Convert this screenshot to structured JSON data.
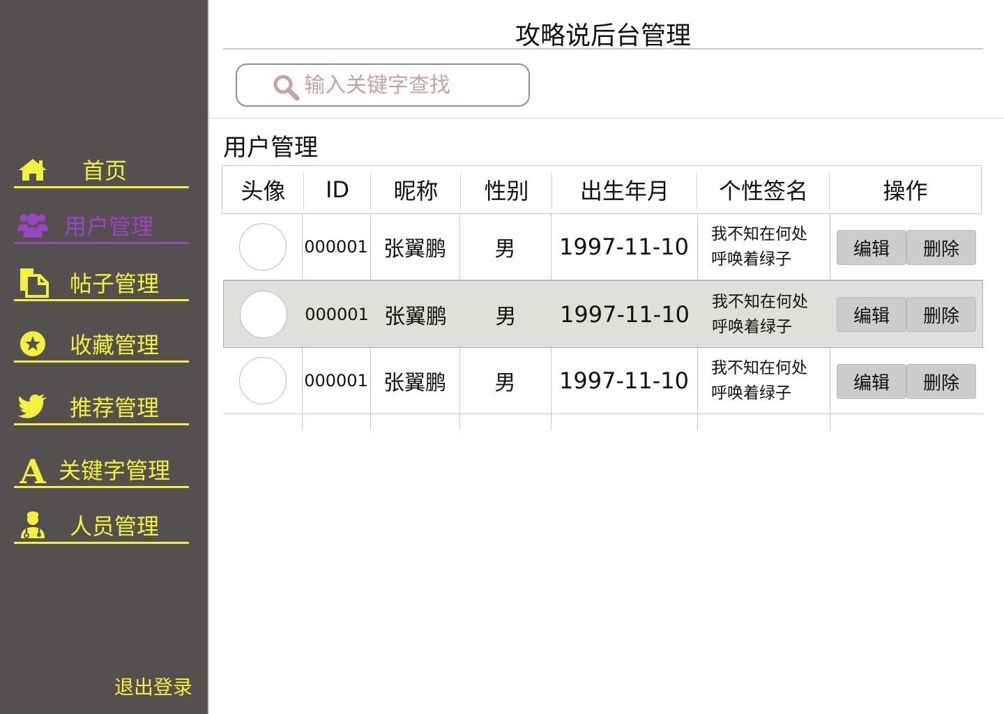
{
  "app": {
    "title": "攻略说后台管理"
  },
  "sidebar": {
    "items": [
      {
        "label": "首页",
        "icon": "home-icon"
      },
      {
        "label": "用户管理",
        "icon": "users-icon",
        "active": true
      },
      {
        "label": "帖子管理",
        "icon": "document-icon"
      },
      {
        "label": "收藏管理",
        "icon": "star-icon"
      },
      {
        "label": "推荐管理",
        "icon": "bird-icon"
      },
      {
        "label": "关键字管理",
        "icon": "letter-a-icon"
      },
      {
        "label": "人员管理",
        "icon": "doctor-icon"
      }
    ],
    "logout_label": "退出登录"
  },
  "search": {
    "placeholder": "输入关键字查找",
    "value": ""
  },
  "section": {
    "title": "用户管理"
  },
  "table": {
    "columns": [
      "头像",
      "ID",
      "昵称",
      "性别",
      "出生年月",
      "个性签名",
      "操作"
    ],
    "rows": [
      {
        "id": "000001",
        "nickname": "张翼鹏",
        "gender": "男",
        "birth": "1997-11-10",
        "signature": "我不知在何处\n呼唤着绿子",
        "edit": "编辑",
        "delete": "删除"
      },
      {
        "id": "000001",
        "nickname": "张翼鹏",
        "gender": "男",
        "birth": "1997-11-10",
        "signature": "我不知在何处\n呼唤着绿子",
        "edit": "编辑",
        "delete": "删除",
        "highlighted": true
      },
      {
        "id": "000001",
        "nickname": "张翼鹏",
        "gender": "男",
        "birth": "1997-11-10",
        "signature": "我不知在何处\n呼唤着绿子",
        "edit": "编辑",
        "delete": "删除"
      }
    ]
  },
  "colors": {
    "sidebar_bg": "#545050",
    "nav_accent": "#f2f23c",
    "active_accent": "#9a45c2",
    "placeholder": "#c9a3a3",
    "highlight_row": "#dfe0dc"
  }
}
